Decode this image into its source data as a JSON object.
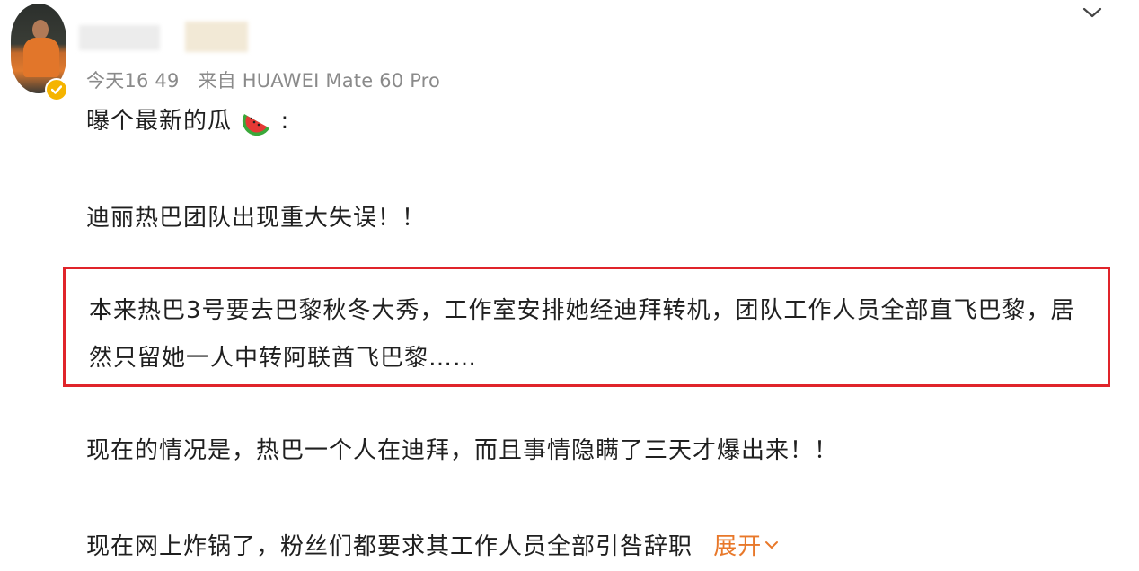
{
  "post": {
    "timestamp": "今天16 49",
    "source": "来自 HUAWEI Mate 60 Pro",
    "lines": [
      "曝个最新的瓜",
      "迪丽热巴团队出现重大失误！！"
    ],
    "watermelon_emoji_icon": "watermelon-icon",
    "colon": ":",
    "highlighted_text": "本来热巴3号要去巴黎秋冬大秀，工作室安排她经迪拜转机，团队工作人员全部直飞巴黎，居然只留她一人中转阿联酋飞巴黎……",
    "line3": "现在的情况是，热巴一个人在迪拜，而且事情隐瞒了三天才爆出来！！",
    "line4": "现在网上炸锅了，粉丝们都要求其工作人员全部引咎辞职",
    "expand_label": "展开"
  },
  "colors": {
    "highlight_border": "#e0242a",
    "expand_link": "#e8782a",
    "meta_text": "#8a8a8a",
    "verified_badge": "#f5b400"
  },
  "icons": {
    "menu": "chevron-down-icon",
    "verified": "verified-badge-icon",
    "expand": "chevron-down-icon"
  }
}
